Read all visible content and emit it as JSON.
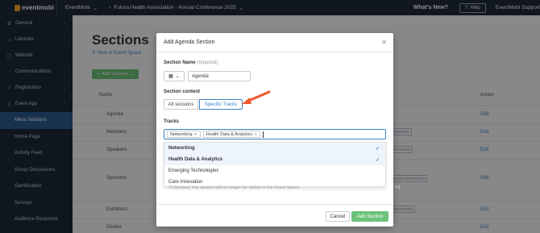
{
  "topbar": {
    "logo_text": "eventmobi",
    "org": "EventMobi",
    "event": "Futura Health Association - Annual Conference 2025",
    "whats_new": "What's New?",
    "help": "Help",
    "user": "EventMobi Support"
  },
  "sidebar": {
    "items": [
      {
        "label": "General",
        "icon": "gear-icon"
      },
      {
        "label": "Libraries",
        "icon": "folder-icon"
      },
      {
        "label": "Website",
        "icon": "monitor-icon"
      },
      {
        "label": "Communications",
        "icon": "chat-icon"
      },
      {
        "label": "Registration",
        "icon": "user-plus-icon"
      },
      {
        "label": "Event App",
        "icon": "phone-icon"
      }
    ],
    "sub_items": [
      "Menu Sections",
      "Home Page",
      "Activity Feed",
      "Group Discussions",
      "Gamification",
      "Surveys",
      "Audience Response"
    ]
  },
  "main": {
    "title": "Sections",
    "view_link": "View in Event Space",
    "add_button": "Add Sections",
    "col_name": "Name",
    "col_action": "Action",
    "rows": [
      {
        "name": "Agenda",
        "edit": "Edit",
        "badge": ""
      },
      {
        "name": "Members",
        "edit": "Edit",
        "badge": "MEMBERS"
      },
      {
        "name": "Speakers",
        "edit": "Edit",
        "badge": "SPEAKERS"
      },
      {
        "name": "Sponsors",
        "edit": "Edit",
        "badge": "SILVER SPONSORS"
      },
      {
        "name": "Exhibitors",
        "edit": "Edit",
        "badge": "EXHIBITORS"
      },
      {
        "name": "Divider",
        "edit": "Edit",
        "badge": ""
      }
    ]
  },
  "modal": {
    "title": "Add Agenda Section",
    "section_name_label": "Section Name",
    "required": "(required)",
    "section_name_value": "Agenda",
    "section_content_label": "Section content",
    "all_sessions": "All sessions",
    "specific_tracks": "Specific Tracks",
    "tracks_label": "Tracks",
    "chips": [
      "Networking",
      "Health Data & Analytics"
    ],
    "options": [
      {
        "label": "Networking",
        "selected": true
      },
      {
        "label": "Health Data & Analytics",
        "selected": true
      },
      {
        "label": "Emerging Technologies",
        "selected": false
      },
      {
        "label": "Care Innovation",
        "selected": false
      }
    ],
    "hidden_note": "If checked, this section will no longer be visible in the Event Space",
    "cancel": "Cancel",
    "add": "Add Section",
    "plus_one": "+1"
  },
  "colors": {
    "accent": "#3b82c4",
    "green": "#6cc27a",
    "arrow": "#f0582e",
    "sidebar": "#1c2836",
    "active": "#2c5b8f"
  }
}
